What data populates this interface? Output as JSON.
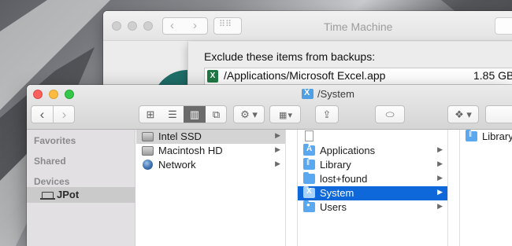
{
  "time_machine": {
    "title": "Time Machine",
    "nav_back": "‹",
    "nav_forward": "›",
    "grid_glyph": "⠿⠿",
    "sheet_title": "Exclude these items from backups:",
    "excluded_items": [
      {
        "icon": "excel-icon",
        "icon_text": "X",
        "path": "/Applications/Microsoft Excel.app",
        "size": "1.85 GB"
      }
    ]
  },
  "finder": {
    "title": "/System",
    "toolbar": {
      "back": "‹",
      "forward": "›",
      "view_icon": "⊞",
      "view_list": "☰",
      "view_columns": "▥",
      "view_coverflow": "⧉",
      "action": "⚙ ▾",
      "arrange": "▦ ▾",
      "share": "⇪",
      "tag": "⬭",
      "dropbox": "❖ ▾"
    },
    "sidebar": {
      "sections": [
        "Favorites",
        "Shared",
        "Devices"
      ],
      "devices": [
        {
          "icon": "laptop-icon",
          "label": "JPot"
        }
      ]
    },
    "columns": [
      {
        "items": [
          {
            "icon": "drive-icon",
            "label": "Intel SSD",
            "has_children": true,
            "selected": "inactive"
          },
          {
            "icon": "drive-icon",
            "label": "Macintosh HD",
            "has_children": true
          },
          {
            "icon": "globe-icon",
            "label": "Network",
            "has_children": true
          }
        ]
      },
      {
        "items": [
          {
            "icon": "document-icon",
            "label": "",
            "has_children": false
          },
          {
            "icon": "applications-folder-icon",
            "label": "Applications",
            "has_children": true
          },
          {
            "icon": "library-folder-icon",
            "label": "Library",
            "has_children": true
          },
          {
            "icon": "folder-icon",
            "label": "lost+found",
            "has_children": true
          },
          {
            "icon": "system-folder-icon",
            "label": "System",
            "has_children": true,
            "selected": "active"
          },
          {
            "icon": "users-folder-icon",
            "label": "Users",
            "has_children": true
          }
        ]
      },
      {
        "items": [
          {
            "icon": "library-folder-icon",
            "label": "Library",
            "has_children": false
          }
        ]
      }
    ],
    "chevron": "▶"
  }
}
